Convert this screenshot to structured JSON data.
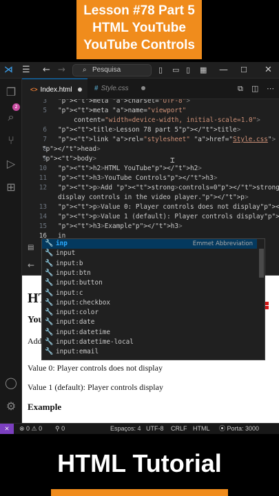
{
  "banner": {
    "line1": "Lesson #78 Part 5",
    "line2": "HTML YouTube",
    "line3": "YouTube Controls"
  },
  "titlebar": {
    "search_placeholder": "Pesquisa"
  },
  "activity": {
    "badge": "2"
  },
  "tabs": [
    {
      "label": "Index.html",
      "icon": "<>"
    },
    {
      "label": "Style.css",
      "icon": "#"
    }
  ],
  "editor": {
    "lines": [
      {
        "n": "3",
        "text": "<meta charset=\"UTF-8\">"
      },
      {
        "n": "5",
        "text": "<meta name=\"viewport\""
      },
      {
        "n": "",
        "text": "content=\"width=device-width, initial-scale=1.0\">"
      },
      {
        "n": "6",
        "text": "<title>Lesson 78 part 5</title>"
      },
      {
        "n": "7",
        "text": "<link rel=\"stylesheet\" href=\"Style.css\">"
      },
      {
        "n": "8",
        "text": "</head>"
      },
      {
        "n": "9",
        "text": "<body>"
      },
      {
        "n": "10",
        "text": "<h2>HTML YouTube</h2>"
      },
      {
        "n": "11",
        "text": "<h3>YouTube Controls</h3>"
      },
      {
        "n": "12",
        "text": "<p>Add <strong>controls=0</strong> to not"
      },
      {
        "n": "",
        "text": "display controls in the video player.</p>"
      },
      {
        "n": "13",
        "text": "<p>Value 0: Player controls does not display</p>"
      },
      {
        "n": "14",
        "text": "<p>Value 1 (default): Player controls display</p>"
      },
      {
        "n": "15",
        "text": "<h3>Example</h3>"
      },
      {
        "n": "16",
        "text": "in"
      }
    ]
  },
  "suggestions": {
    "hint": "Emmet Abbreviation",
    "items": [
      "inp",
      "input",
      "input:b",
      "input:btn",
      "input:button",
      "input:c",
      "input:checkbox",
      "input:color",
      "input:date",
      "input:datetime",
      "input:datetime-local",
      "input:email"
    ]
  },
  "preview": {
    "h2": "HTM",
    "h3": "You",
    "p1": "Add",
    "p2": "Value 0: Player controls does not display",
    "p3": "Value 1 (default): Player controls display",
    "h3b": "Example"
  },
  "statusbar": {
    "problems": "0 ⚠ 0",
    "ports": "0",
    "spaces": "Espaços: 4",
    "encoding": "UTF-8",
    "eol": "CRLF",
    "language": "HTML",
    "port": "Porta: 3000"
  },
  "bottom": {
    "title": "HTML Tutorial"
  },
  "colors": {
    "accent": "#f08c1c",
    "selection": "#04395e",
    "remote": "#7b3fbf"
  }
}
